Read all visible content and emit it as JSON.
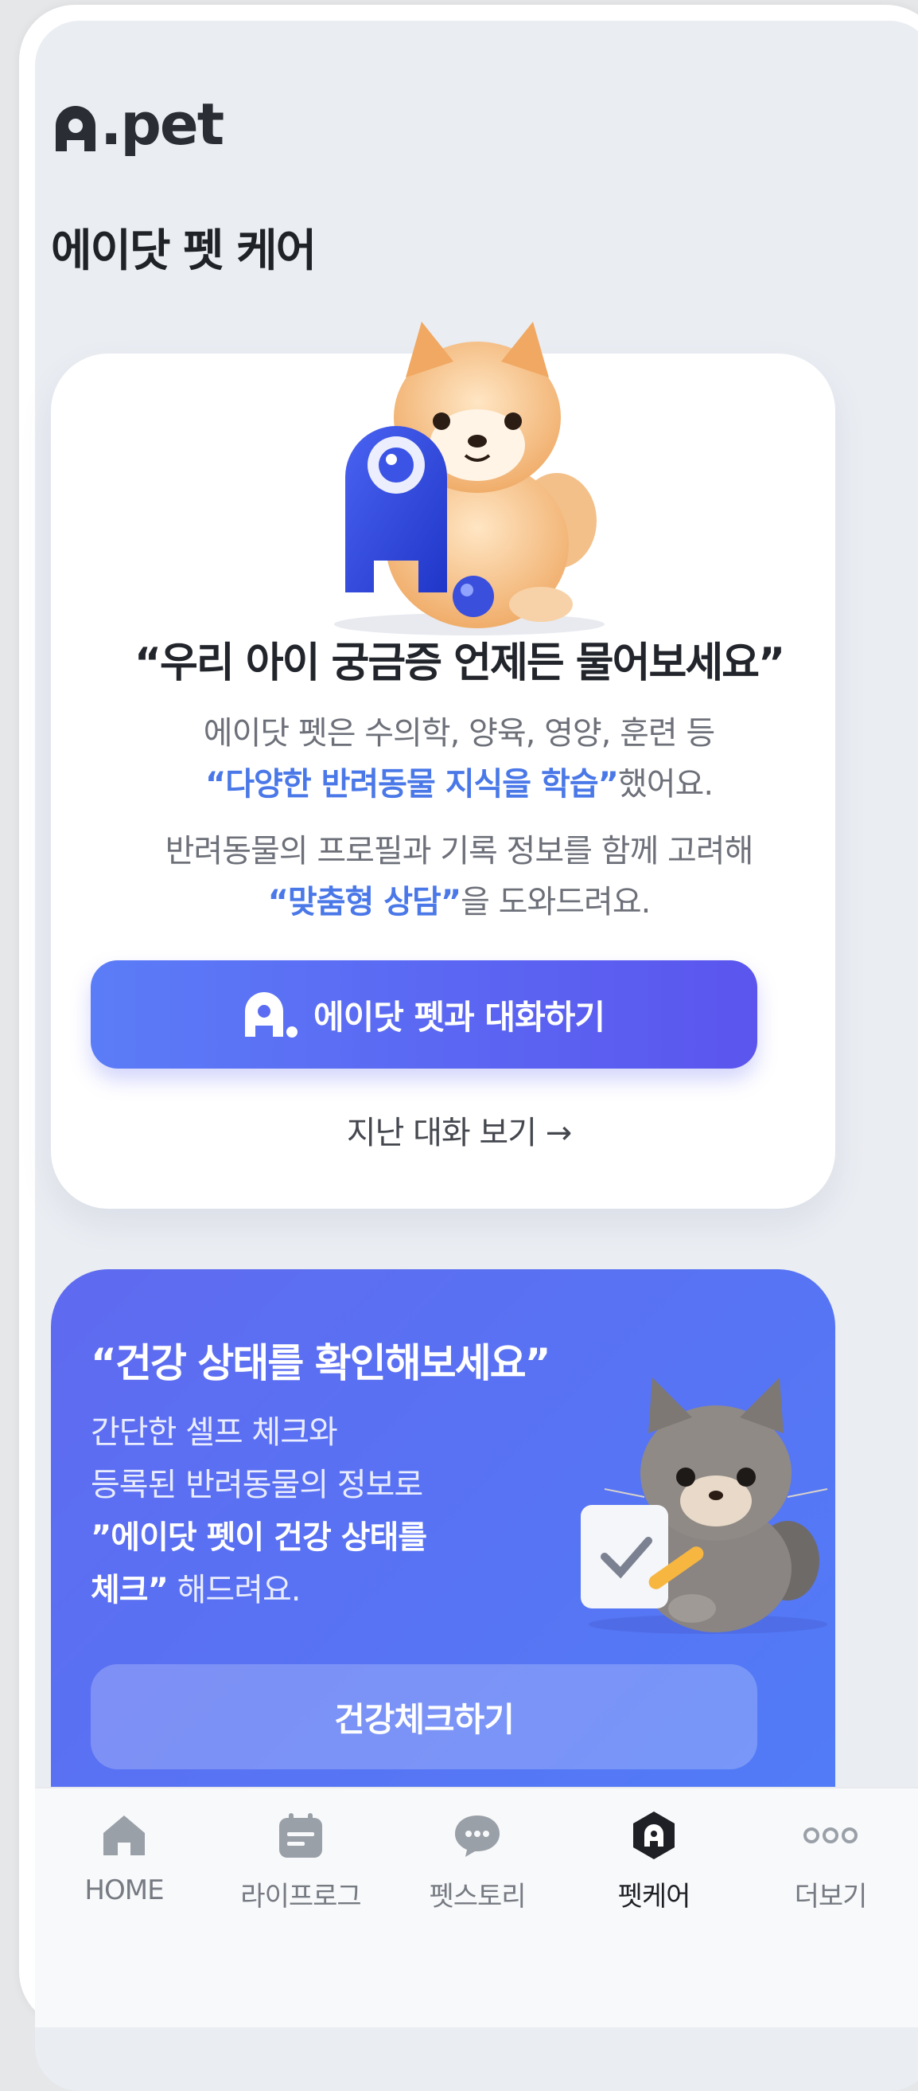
{
  "app": {
    "logo_text": "A.pet",
    "page_title": "에이닷 펫 케어"
  },
  "ai_card": {
    "headline": "“우리 아이 궁금증 언제든 물어보세요”",
    "line1": "에이닷 펫은 수의학, 양육, 영양, 훈련 등",
    "line2_highlight": "“다양한 반려동물 지식을 학습”",
    "line2_rest": "했어요.",
    "line3": "반려동물의 프로필과 기록 정보를 함께 고려해",
    "line4_highlight": "“맞춤형 상담”",
    "line4_rest": "을 도와드려요.",
    "chat_button_label": "에이닷 펫과 대화하기",
    "past_chats_label": "지난 대화 보기 →"
  },
  "health_card": {
    "headline": "“건강 상태를 확인해보세요”",
    "line1": "간단한 셀프 체크와",
    "line2": "등록된 반려동물의 정보로",
    "line3_bold": "”에이닷 펫이 건강 상태를",
    "line4_bold": "체크”",
    "line4_rest": " 해드려요.",
    "button_label": "건강체크하기"
  },
  "tabbar": {
    "items": [
      {
        "label": "HOME",
        "icon": "home-icon"
      },
      {
        "label": "라이프로그",
        "icon": "lifelog-icon"
      },
      {
        "label": "펫스토리",
        "icon": "chat-bubble-icon"
      },
      {
        "label": "펫케어",
        "icon": "petcare-icon",
        "active": true
      },
      {
        "label": "더보기",
        "icon": "more-icon"
      }
    ]
  },
  "colors": {
    "accent": "#4a78e8",
    "button_gradient_start": "#5b7cf7",
    "button_gradient_end": "#5b55ee",
    "health_card_bg": "#5874f4",
    "screen_bg": "#eaedf2"
  }
}
